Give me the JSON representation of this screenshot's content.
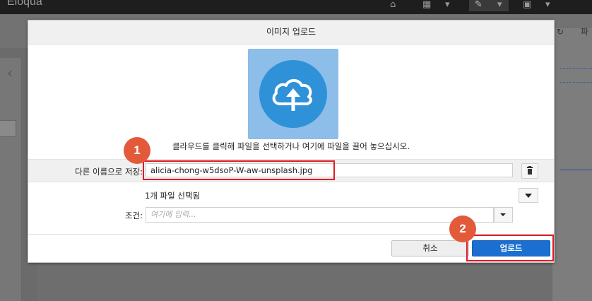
{
  "app": {
    "title": "Eloqua"
  },
  "background": {
    "right_label": "파"
  },
  "dialog": {
    "title": "이미지 업로드",
    "upload_hint": "클라우드를 클릭해 파일을 선택하거나 여기에 파일을 끌어 놓으십시오.",
    "save_as_label": "다른 이름으로 저장:",
    "save_as_value": "alicia-chong-w5dsoP-W-aw-unsplash.jpg",
    "selected_files_text": "1개 파일 선택됨",
    "condition_label": "조건:",
    "condition_placeholder": "여기에 입력...",
    "cancel_label": "취소",
    "upload_label": "업로드"
  },
  "annotations": {
    "badge_1": "1",
    "badge_2": "2",
    "highlight_color": "#e01b24",
    "badge_color": "#e35a3b"
  },
  "colors": {
    "accent": "#1a6fd0",
    "upload_tile": "#8dbde9",
    "upload_circle": "#2f92d8"
  }
}
